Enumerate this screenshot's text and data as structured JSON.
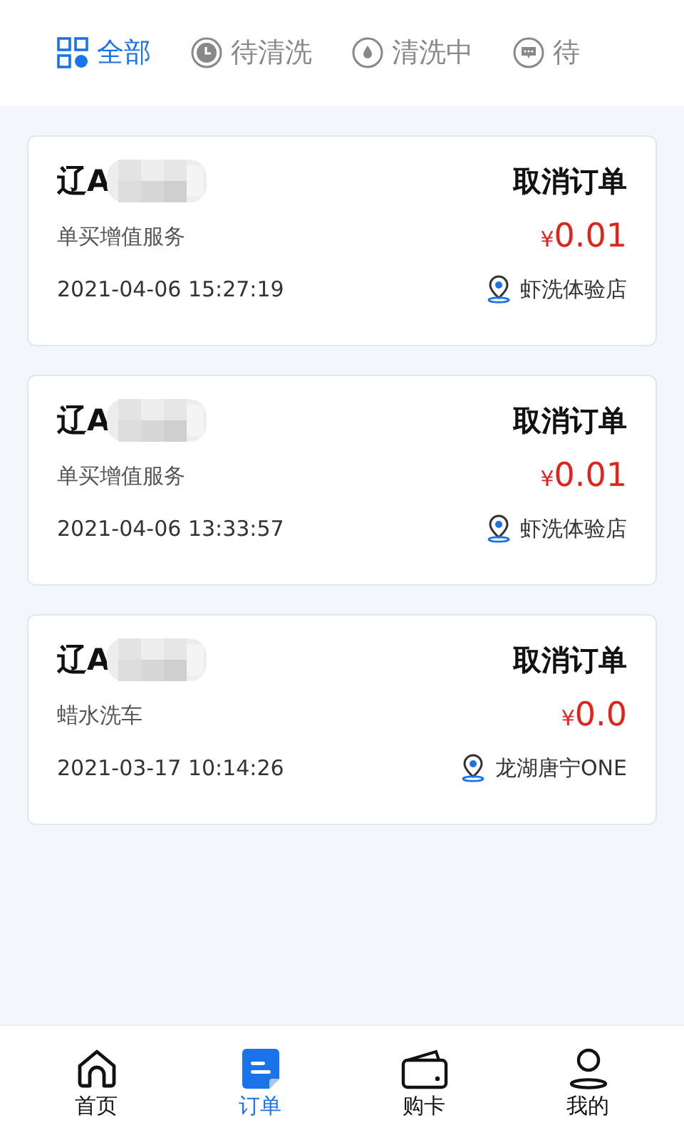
{
  "tabs": [
    {
      "label": "全部",
      "selected": true
    },
    {
      "label": "待清洗",
      "selected": false
    },
    {
      "label": "清洗中",
      "selected": false
    },
    {
      "label": "待",
      "selected": false
    }
  ],
  "orders": [
    {
      "plate": "辽A",
      "action": "取消订单",
      "service": "单买增值服务",
      "currency": "¥",
      "price": "0.01",
      "time": "2021-04-06 15:27:19",
      "store": "虾洗体验店"
    },
    {
      "plate": "辽A",
      "action": "取消订单",
      "service": "单买增值服务",
      "currency": "¥",
      "price": "0.01",
      "time": "2021-04-06 13:33:57",
      "store": "虾洗体验店"
    },
    {
      "plate": "辽A",
      "action": "取消订单",
      "service": "蜡水洗车",
      "currency": "¥",
      "price": "0.0",
      "time": "2021-03-17 10:14:26",
      "store": "龙湖唐宁ONE"
    }
  ],
  "nav": [
    {
      "label": "首页",
      "selected": false
    },
    {
      "label": "订单",
      "selected": true
    },
    {
      "label": "购卡",
      "selected": false
    },
    {
      "label": "我的",
      "selected": false
    }
  ]
}
